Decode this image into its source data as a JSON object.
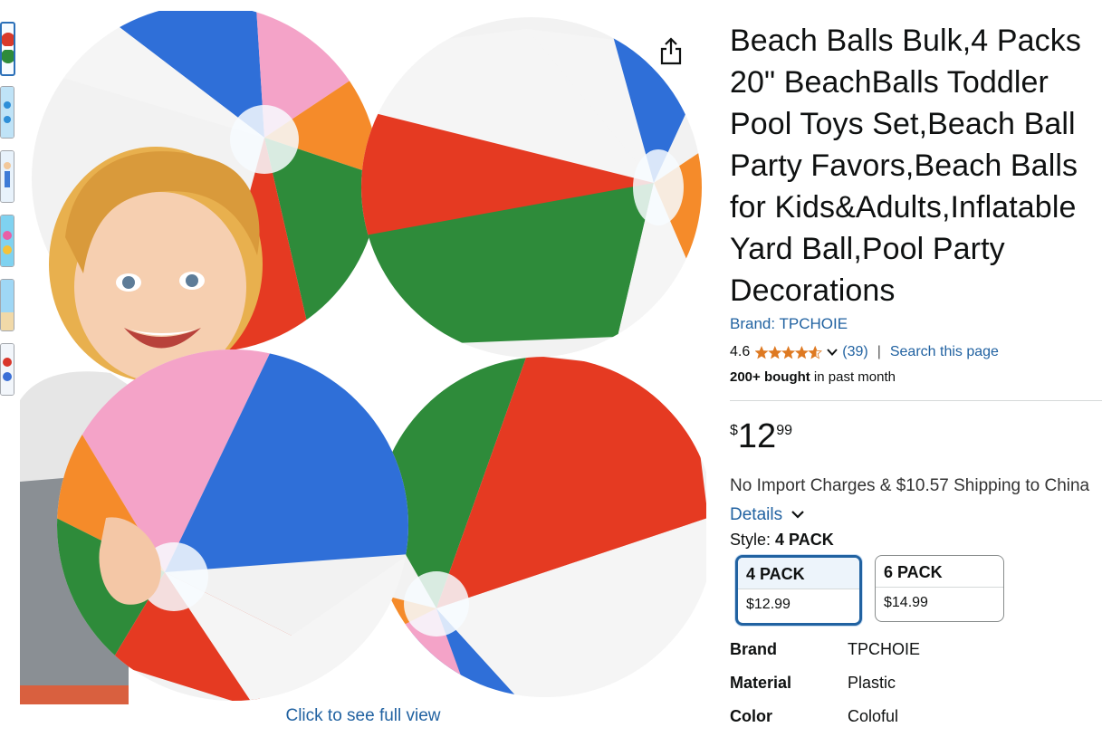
{
  "product": {
    "title": "Beach Balls Bulk,4 Packs 20\" BeachBalls Toddler Pool Toys Set,Beach Ball Party Favors,Beach Balls for Kids&Adults,Inflatable Yard Ball,Pool Party Decorations",
    "brand_link": "Brand: TPCHOIE",
    "rating": "4.6",
    "rating_stars": 4.6,
    "review_count": "(39)",
    "separator": "|",
    "search_link": "Search this page",
    "bought_bold": "200+ bought",
    "bought_rest": " in past month"
  },
  "price": {
    "currency": "$",
    "whole": "12",
    "fraction": "99"
  },
  "shipping": {
    "text": "No Import Charges & $10.57 Shipping to China ",
    "details_link": "Details"
  },
  "style": {
    "label": "Style: ",
    "selected": "4 PACK",
    "options": [
      {
        "name": "4 PACK",
        "price": "$12.99"
      },
      {
        "name": "6 PACK",
        "price": "$14.99"
      }
    ]
  },
  "specs": [
    {
      "key": "Brand",
      "value": "TPCHOIE"
    },
    {
      "key": "Material",
      "value": "Plastic"
    },
    {
      "key": "Color",
      "value": "Coloful"
    }
  ],
  "gallery": {
    "full_view": "Click to see full view"
  },
  "icons": {
    "share": "share-icon",
    "chevron": "chevron-down-icon",
    "star": "star-icon"
  },
  "colors": {
    "link": "#2162a1",
    "star": "#de7921",
    "selected_border": "#2162a1"
  }
}
